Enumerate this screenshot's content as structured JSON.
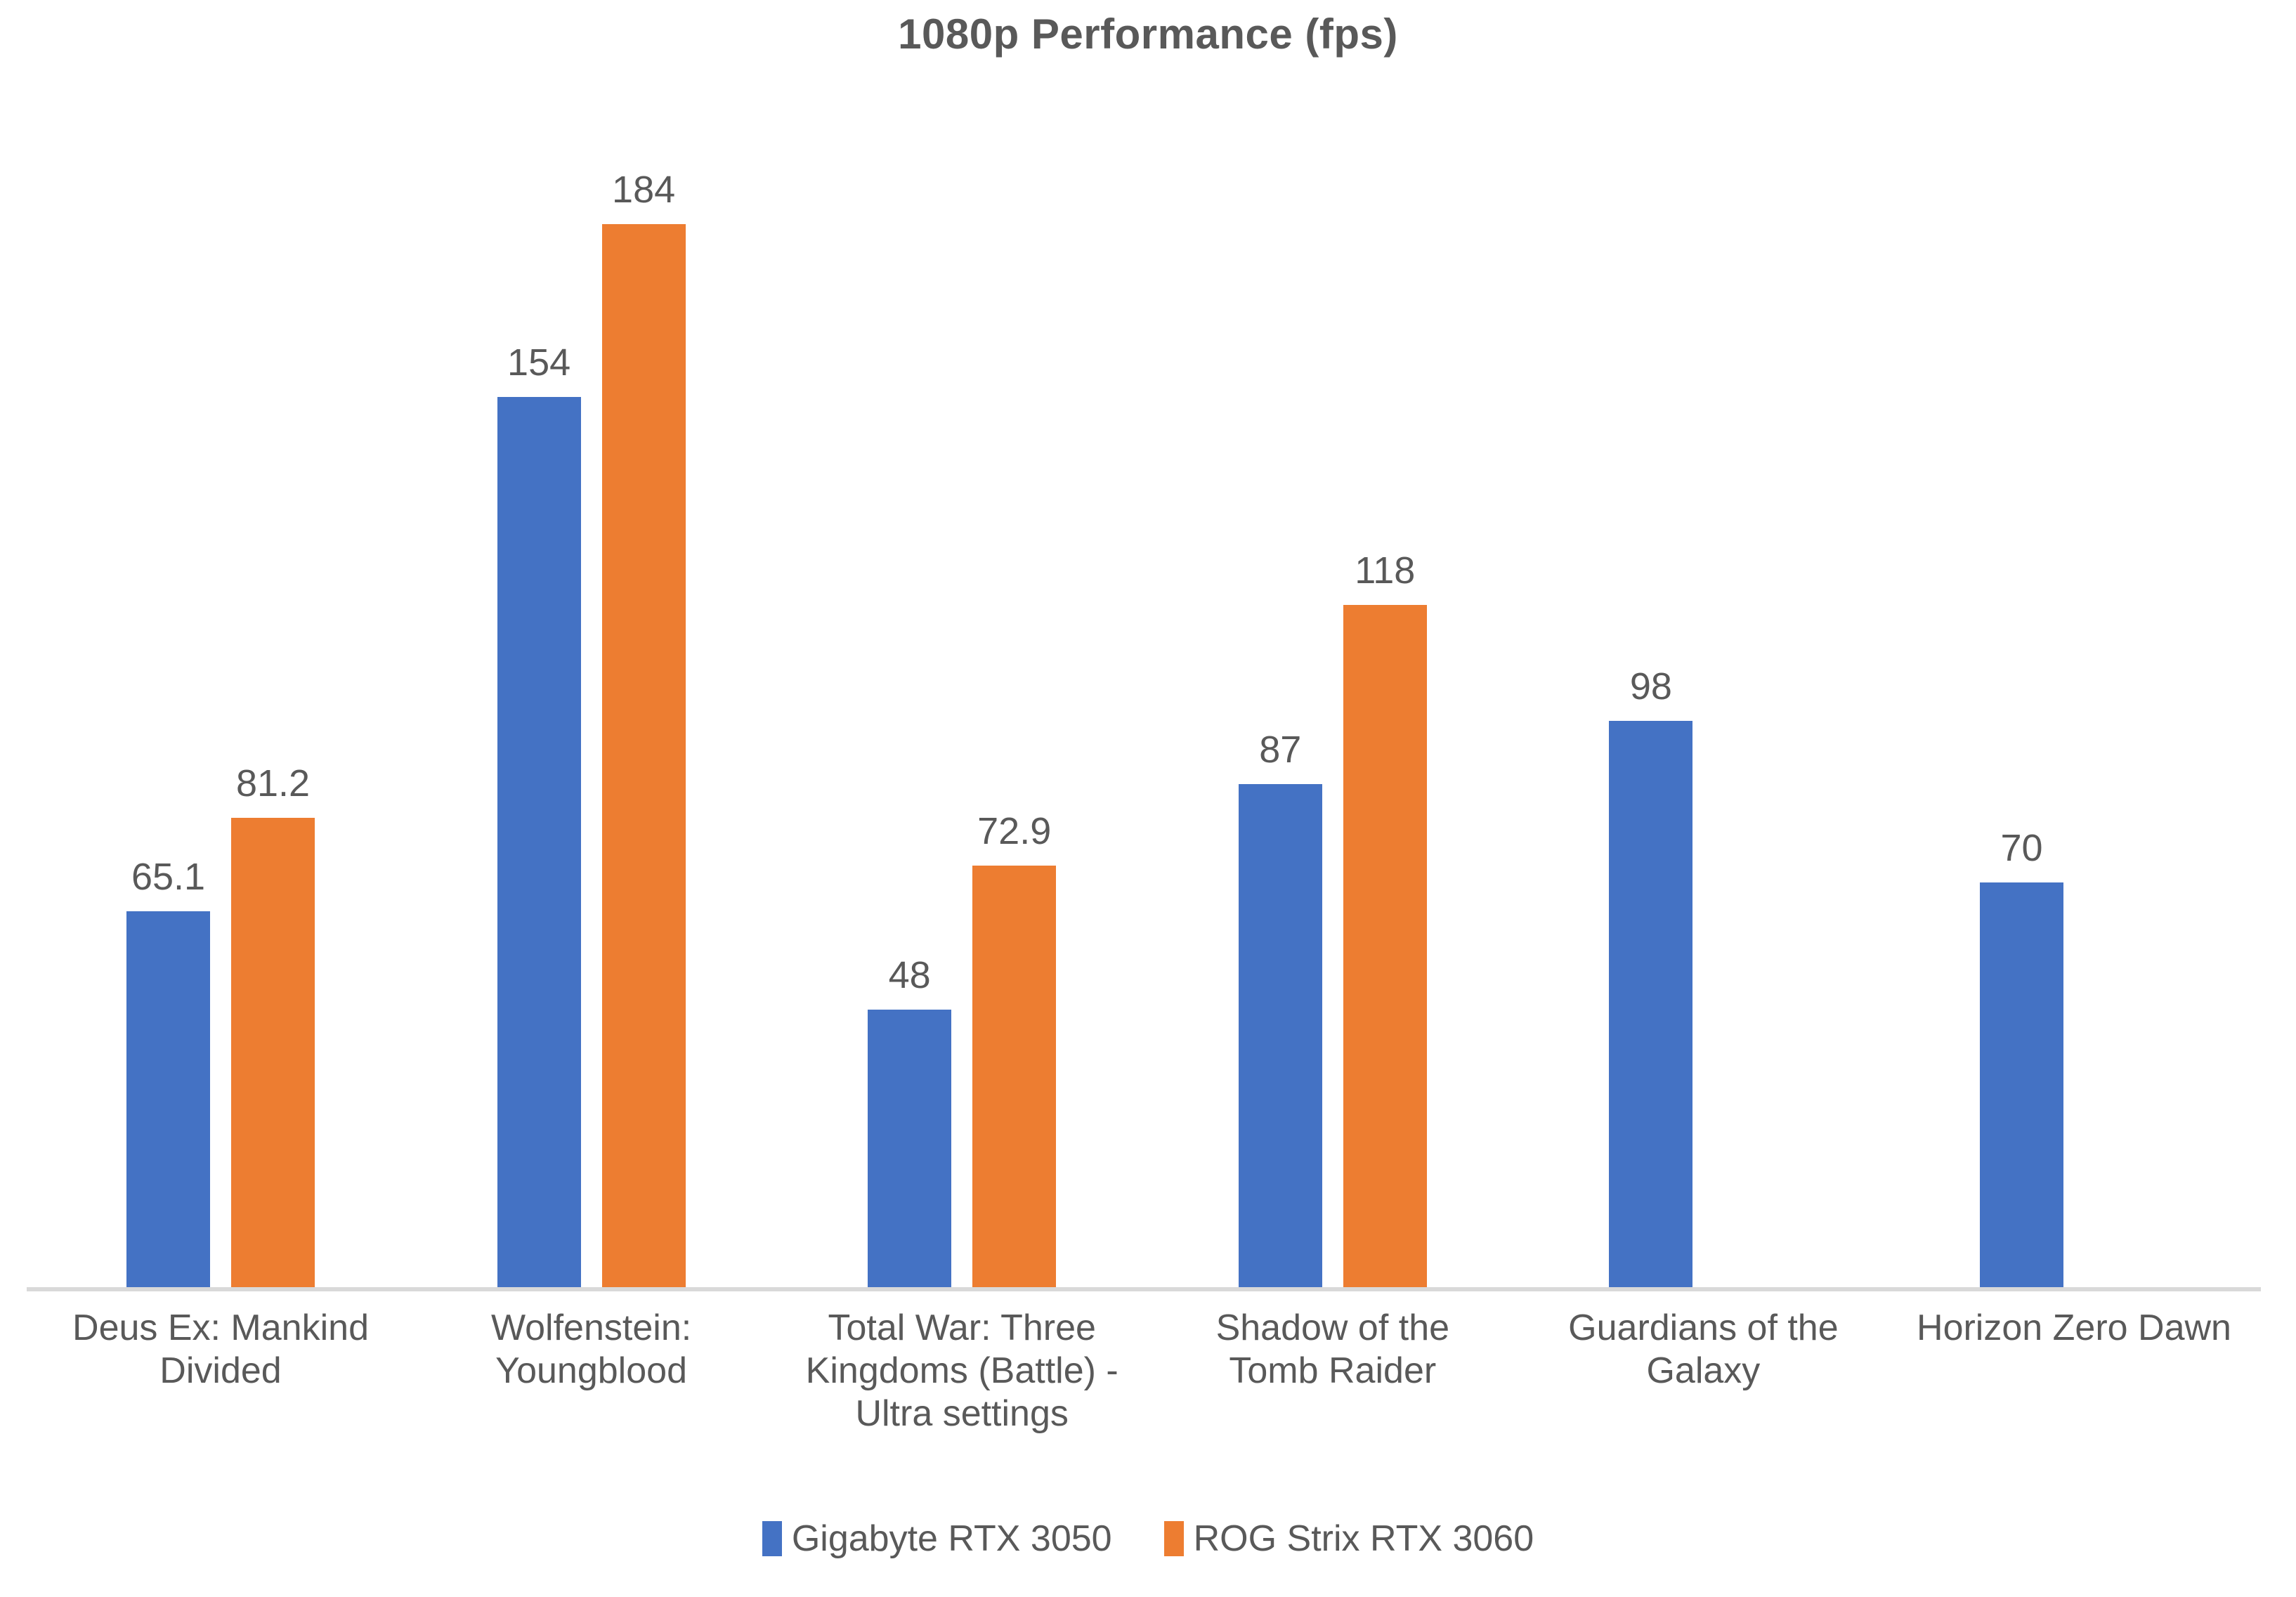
{
  "chart_data": {
    "type": "bar",
    "title": "1080p Performance (fps)",
    "xlabel": "",
    "ylabel": "",
    "ylim": [
      0,
      184
    ],
    "grid": false,
    "legend_position": "bottom",
    "categories": [
      "Deus Ex: Mankind Divided",
      "Wolfenstein: Youngblood",
      "Total War: Three Kingdoms (Battle) - Ultra settings",
      "Shadow of the Tomb Raider",
      "Guardians of the Galaxy",
      "Horizon Zero Dawn"
    ],
    "category_lines": [
      [
        "Deus Ex: Mankind",
        "Divided"
      ],
      [
        "Wolfenstein:",
        "Youngblood"
      ],
      [
        "Total War: Three",
        "Kingdoms (Battle) -",
        "Ultra settings"
      ],
      [
        "Shadow of the",
        "Tomb Raider"
      ],
      [
        "Guardians of the",
        "Galaxy"
      ],
      [
        "Horizon Zero Dawn"
      ]
    ],
    "series": [
      {
        "name": "Gigabyte RTX 3050",
        "color": "#4472C4",
        "values": [
          65.1,
          154,
          48,
          87,
          98,
          70
        ],
        "labels": [
          "65.1",
          "154",
          "48",
          "87",
          "98",
          "70"
        ]
      },
      {
        "name": "ROG Strix RTX 3060",
        "color": "#ED7D31",
        "values": [
          81.2,
          184,
          72.9,
          118,
          null,
          null
        ],
        "labels": [
          "81.2",
          "184",
          "72.9",
          "118",
          "",
          ""
        ]
      }
    ],
    "axis_color": "#d9d9d9",
    "text_color": "#595959"
  }
}
